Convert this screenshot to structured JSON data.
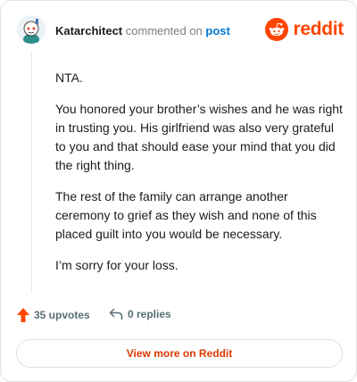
{
  "header": {
    "username": "Katarchitect",
    "action_text": "commented on",
    "post_link": "post",
    "logo_text": "reddit",
    "avatar_icon": "snoo-avatar-icon",
    "brand_color": "#ff4500"
  },
  "comment": {
    "paragraphs": [
      "NTA.",
      "You honored your brother’s wishes and he was right in trusting you. His girlfriend was also very grateful to you and that should ease your mind that you did the right thing.",
      "The rest of the family can arrange another ceremony to grief as they wish and none of this placed guilt into you would be necessary.",
      "I’m sorry for your loss."
    ]
  },
  "footer": {
    "upvotes_label": "35 upvotes",
    "replies_label": "0 replies",
    "upvote_icon": "upvote-arrow-icon",
    "reply_icon": "reply-arrow-icon",
    "upvote_color": "#ff4500"
  },
  "view_button": {
    "label": "View more on Reddit"
  }
}
